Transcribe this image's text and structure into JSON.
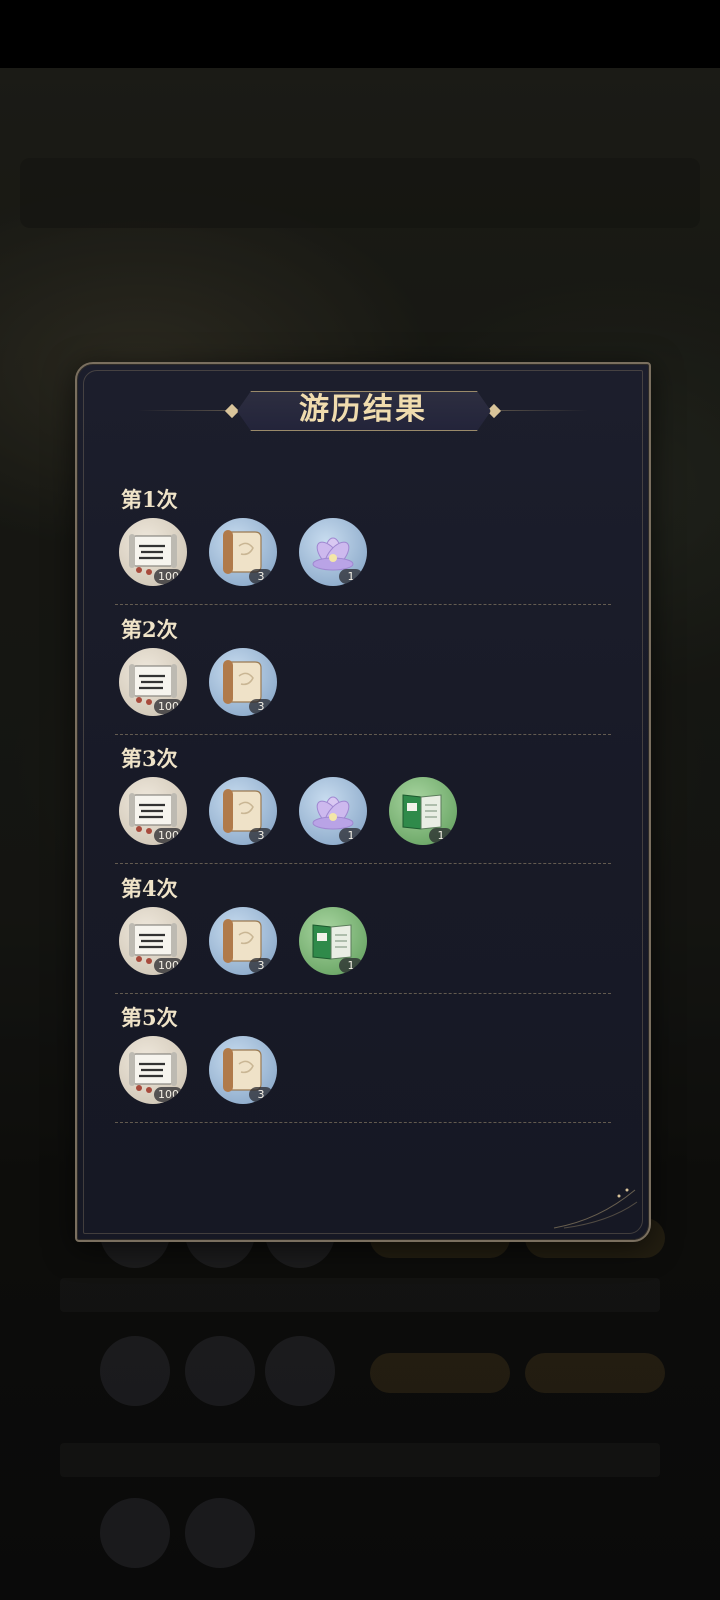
{
  "dialog": {
    "title": "游历结果",
    "rounds": [
      {
        "label": "第1次",
        "items": [
          {
            "icon": "cloth-scroll-icon",
            "qty": "100"
          },
          {
            "icon": "parchment-scroll-icon",
            "qty": "3"
          },
          {
            "icon": "lotus-icon",
            "qty": "1"
          }
        ]
      },
      {
        "label": "第2次",
        "items": [
          {
            "icon": "cloth-scroll-icon",
            "qty": "100"
          },
          {
            "icon": "parchment-scroll-icon",
            "qty": "3"
          }
        ]
      },
      {
        "label": "第3次",
        "items": [
          {
            "icon": "cloth-scroll-icon",
            "qty": "100"
          },
          {
            "icon": "parchment-scroll-icon",
            "qty": "3"
          },
          {
            "icon": "lotus-icon",
            "qty": "1"
          },
          {
            "icon": "green-book-icon",
            "qty": "1"
          }
        ]
      },
      {
        "label": "第4次",
        "items": [
          {
            "icon": "cloth-scroll-icon",
            "qty": "100"
          },
          {
            "icon": "parchment-scroll-icon",
            "qty": "3"
          },
          {
            "icon": "green-book-icon",
            "qty": "1"
          }
        ]
      },
      {
        "label": "第5次",
        "items": [
          {
            "icon": "cloth-scroll-icon",
            "qty": "100"
          },
          {
            "icon": "parchment-scroll-icon",
            "qty": "3"
          }
        ]
      }
    ]
  },
  "colors": {
    "panel": "#1a1c29",
    "title_text": "#f0dcae",
    "border_gold": "#7a6f5f"
  }
}
